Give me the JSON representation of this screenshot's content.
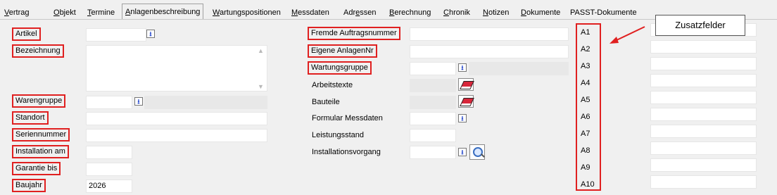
{
  "tabs": [
    {
      "pre": "",
      "u": "V",
      "post": "ertrag",
      "active": false
    },
    {
      "pre": "",
      "u": "O",
      "post": "bjekt",
      "active": false
    },
    {
      "pre": "",
      "u": "T",
      "post": "ermine",
      "active": false
    },
    {
      "pre": "",
      "u": "A",
      "post": "nlagenbeschreibung",
      "active": true
    },
    {
      "pre": "",
      "u": "W",
      "post": "artungspositionen",
      "active": false
    },
    {
      "pre": "",
      "u": "M",
      "post": "essdaten",
      "active": false
    },
    {
      "pre": "Adr",
      "u": "e",
      "post": "ssen",
      "active": false
    },
    {
      "pre": "",
      "u": "B",
      "post": "erechnung",
      "active": false
    },
    {
      "pre": "",
      "u": "C",
      "post": "hronik",
      "active": false
    },
    {
      "pre": "",
      "u": "N",
      "post": "otizen",
      "active": false
    },
    {
      "pre": "",
      "u": "D",
      "post": "okumente",
      "active": false
    },
    {
      "pre": "PASST-Dokumente",
      "u": "",
      "post": "",
      "active": false
    }
  ],
  "left": {
    "artikel": "Artikel",
    "bezeichnung": "Bezeichnung",
    "warengruppe": "Warengruppe",
    "standort": "Standort",
    "seriennummer": "Seriennummer",
    "installation_am": "Installation am",
    "garantie_bis": "Garantie bis",
    "baujahr": "Baujahr",
    "baujahr_value": "2026"
  },
  "middle": {
    "fremde_auftragsnummer": "Fremde Auftragsnummer",
    "eigene_anlagennr": "Eigene AnlagenNr",
    "wartungsgruppe": "Wartungsgruppe",
    "arbeitstexte": "Arbeitstexte",
    "bauteile": "Bauteile",
    "formular_messdaten": "Formular Messdaten",
    "leistungsstand": "Leistungsstand",
    "installationsvorgang": "Installationsvorgang"
  },
  "extra_fields": {
    "labels": [
      "A1",
      "A2",
      "A3",
      "A4",
      "A5",
      "A6",
      "A7",
      "A8",
      "A9",
      "A10"
    ],
    "callout": "Zusatzfelder"
  },
  "icons": {
    "dropdown": "⭳",
    "eraser": "eraser-icon",
    "magnifier": "magnifier-icon"
  }
}
